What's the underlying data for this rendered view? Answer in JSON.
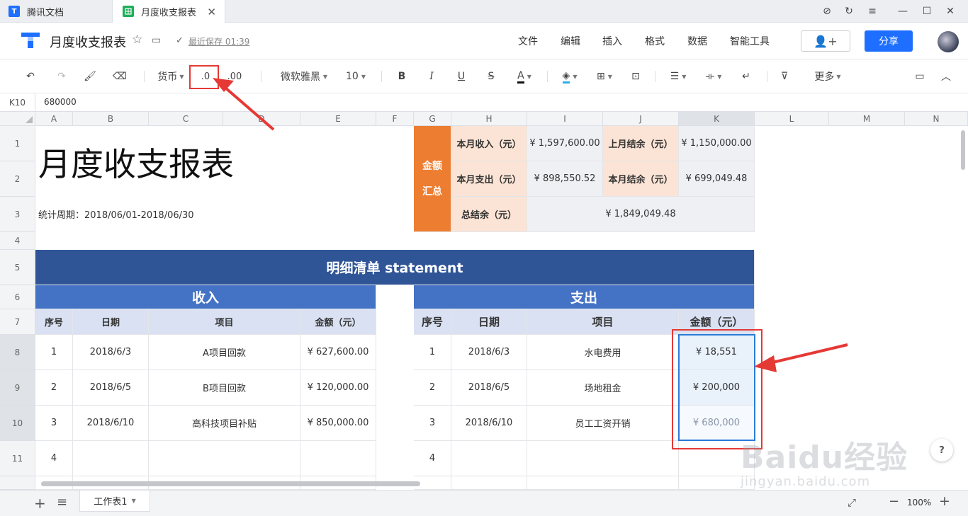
{
  "tabs": [
    {
      "label": "腾讯文档"
    },
    {
      "label": "月度收支报表"
    }
  ],
  "header": {
    "title": "月度收支报表",
    "saved": "最近保存 01:39",
    "menus": [
      "文件",
      "编辑",
      "插入",
      "格式",
      "数据",
      "智能工具"
    ],
    "share": "分享"
  },
  "toolbar": {
    "currency": "货币",
    "dec_decrease": ".0",
    "dec_increase": ".00",
    "font": "微软雅黑",
    "size": "10",
    "more": "更多"
  },
  "formula": {
    "cell": "K10",
    "value": "680000"
  },
  "columns": [
    "A",
    "B",
    "C",
    "D",
    "E",
    "F",
    "G",
    "H",
    "I",
    "J",
    "K",
    "L",
    "M",
    "N"
  ],
  "rows": [
    "1",
    "2",
    "3",
    "4",
    "5",
    "6",
    "7",
    "8",
    "9",
    "10",
    "11"
  ],
  "sheet": {
    "title": "月度收支报表",
    "period": "统计周期：2018/06/01-2018/06/30",
    "summary": {
      "label_top": "金额",
      "label_bottom": "汇总",
      "income_label": "本月收入（元）",
      "income_value": "¥ 1,597,600.00",
      "expense_label": "本月支出（元）",
      "expense_value": "¥ 898,550.52",
      "last_balance_label": "上月结余（元）",
      "last_balance_value": "¥ 1,150,000.00",
      "month_balance_label": "本月结余（元）",
      "month_balance_value": "¥ 699,049.48",
      "total_label": "总结余（元）",
      "total_value": "¥ 1,849,049.48"
    },
    "banner": "明细清单 statement",
    "income_title": "收入",
    "expense_title": "支出",
    "headers": [
      "序号",
      "日期",
      "项目",
      "金额（元）"
    ],
    "income_rows": [
      [
        "1",
        "2018/6/3",
        "A项目回款",
        "¥ 627,600.00"
      ],
      [
        "2",
        "2018/6/5",
        "B项目回款",
        "¥ 120,000.00"
      ],
      [
        "3",
        "2018/6/10",
        "高科技项目补贴",
        "¥ 850,000.00"
      ],
      [
        "4",
        "",
        "",
        ""
      ]
    ],
    "expense_rows": [
      [
        "1",
        "2018/6/3",
        "水电费用",
        "¥ 18,551"
      ],
      [
        "2",
        "2018/6/5",
        "场地租金",
        "¥ 200,000"
      ],
      [
        "3",
        "2018/6/10",
        "员工工资开销",
        "¥ 680,000"
      ],
      [
        "4",
        "",
        "",
        ""
      ]
    ]
  },
  "footer": {
    "sheet_tab": "工作表1",
    "zoom": "100%"
  },
  "watermark": {
    "line1": "Baidu经验",
    "line2": "jingyan.baidu.com"
  }
}
